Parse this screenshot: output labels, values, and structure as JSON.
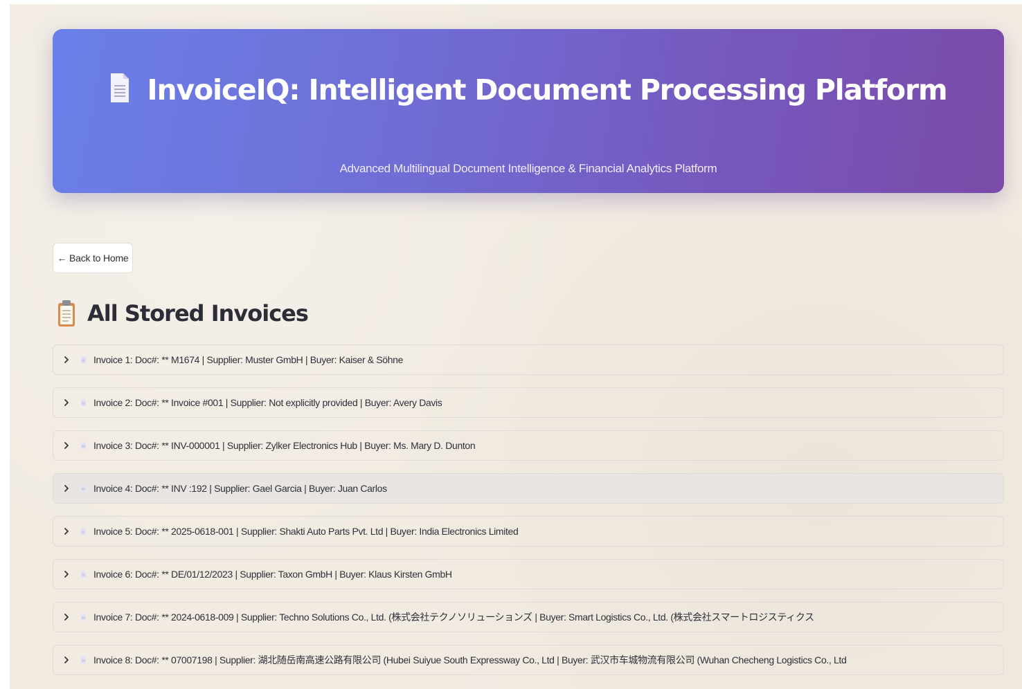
{
  "header": {
    "title": "InvoiceIQ: Intelligent Document Processing Platform",
    "subtitle": "Advanced Multilingual Document Intelligence & Financial Analytics Platform",
    "title_icon": "document-icon"
  },
  "nav": {
    "back_label": "← Back to Home"
  },
  "section": {
    "title": "All Stored Invoices",
    "icon": "clipboard-icon"
  },
  "invoices": [
    {
      "label": "Invoice 1: Doc#: ** M1674 | Supplier: Muster GmbH | Buyer: Kaiser & Söhne"
    },
    {
      "label": "Invoice 2: Doc#: ** Invoice #001 | Supplier: Not explicitly provided | Buyer: Avery Davis"
    },
    {
      "label": "Invoice 3: Doc#: ** INV-000001 | Supplier: Zylker Electronics Hub | Buyer: Ms. Mary D. Dunton"
    },
    {
      "label": "Invoice 4: Doc#: ** INV :192 | Supplier: Gael Garcia | Buyer: Juan Carlos"
    },
    {
      "label": "Invoice 5: Doc#: ** 2025-0618-001 | Supplier: Shakti Auto Parts Pvt. Ltd | Buyer: India Electronics Limited"
    },
    {
      "label": "Invoice 6: Doc#: ** DE/01/12/2023 | Supplier: Taxon GmbH | Buyer: Klaus Kirsten GmbH"
    },
    {
      "label": "Invoice 7: Doc#: ** 2024-0618-009 | Supplier: Techno Solutions Co., Ltd. (株式会社テクノソリューションズ | Buyer: Smart Logistics Co., Ltd. (株式会社スマートロジスティクス"
    },
    {
      "label": "Invoice 8: Doc#: ** 07007198 | Supplier: 湖北随岳南高速公路有限公司 (Hubei Suiyue South Expressway Co., Ltd | Buyer: 武汉市车城物流有限公司 (Wuhan Checheng Logistics Co., Ltd"
    }
  ],
  "colors": {
    "hero_gradient_start": "#6a80e8",
    "hero_gradient_end": "#7a4ba8",
    "page_background": "#f1ebe2"
  }
}
